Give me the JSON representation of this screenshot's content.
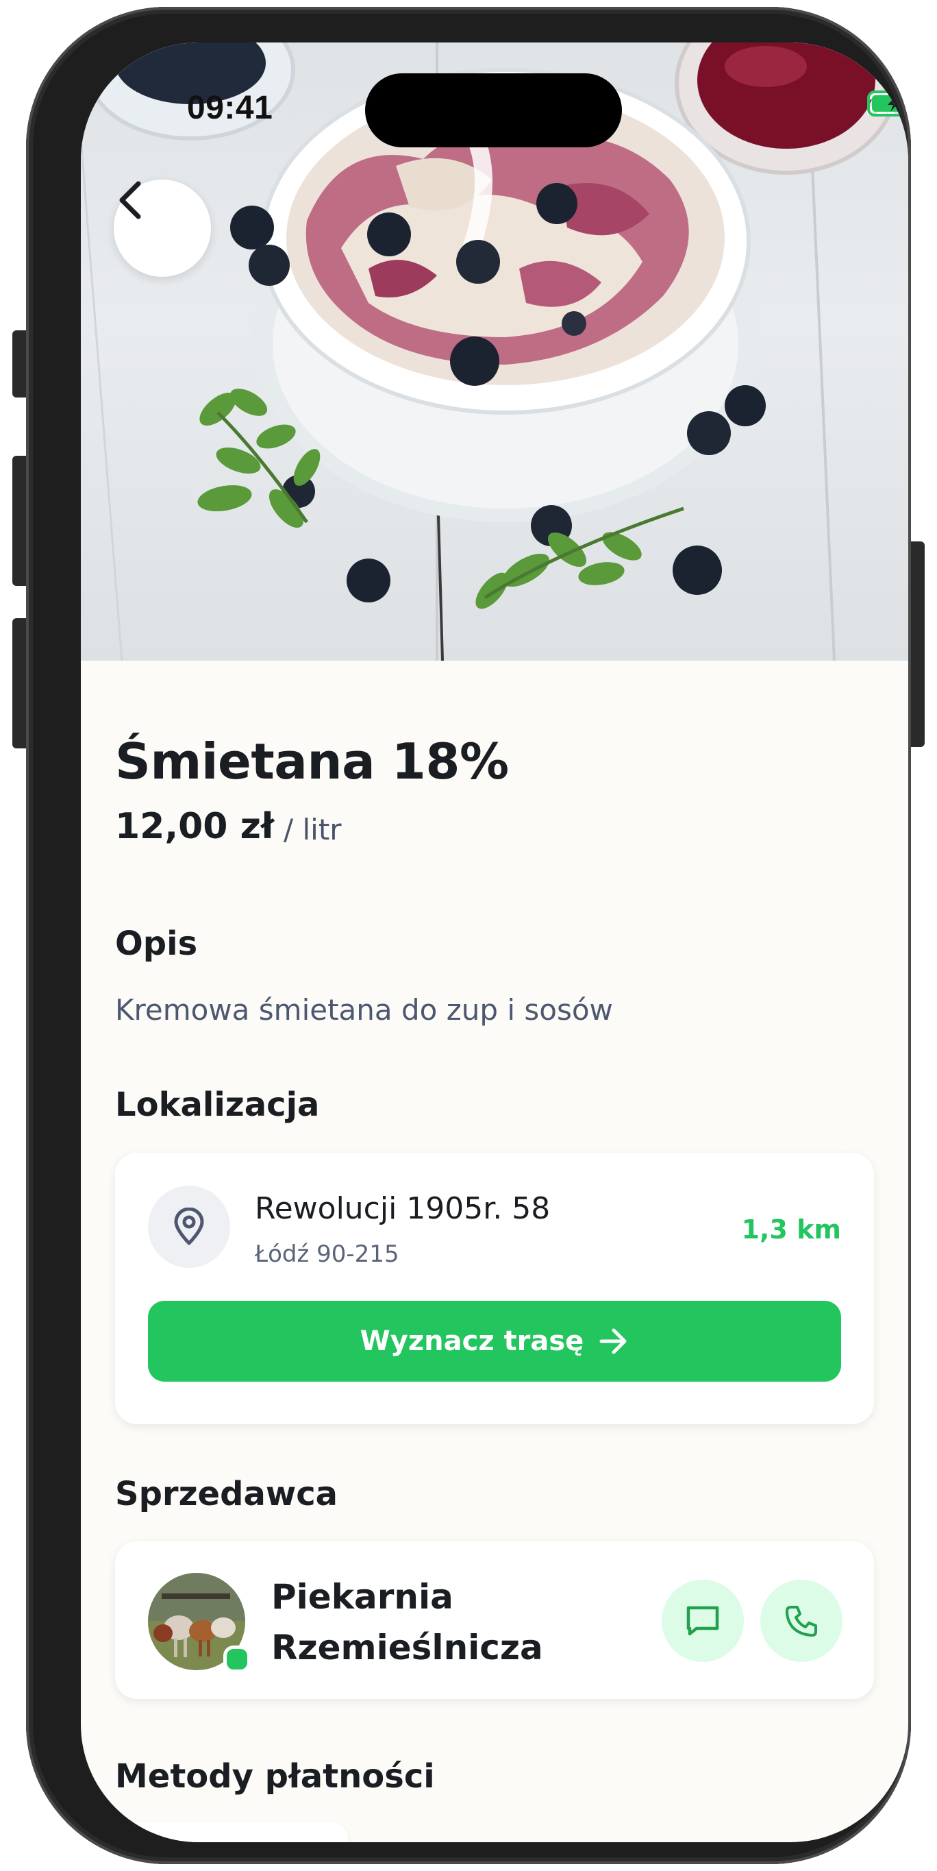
{
  "status_bar": {
    "time": "09:41"
  },
  "product": {
    "title": "Śmietana 18%",
    "price": "12,00 zł",
    "unit": "/ litr"
  },
  "description": {
    "heading": "Opis",
    "text": "Kremowa śmietana do zup i sosów"
  },
  "location": {
    "heading": "Lokalizacja",
    "address_line1": "Rewolucji 1905r. 58",
    "address_line2": "Łódź 90-215",
    "distance": "1,3 km",
    "route_button_label": "Wyznacz trasę"
  },
  "seller": {
    "heading": "Sprzedawca",
    "name": "Piekarnia Rzemieślnicza",
    "online": true
  },
  "payment": {
    "heading": "Metody płatności"
  },
  "colors": {
    "accent": "#22c55e",
    "accent_light": "#dcfce7",
    "background": "#fcfbf8",
    "text_primary": "#1a1d22",
    "text_secondary": "#4d5870"
  },
  "icons": {
    "back": "chevron-left-icon",
    "location": "map-pin-icon",
    "route": "arrow-right-icon",
    "message": "message-icon",
    "phone": "phone-icon"
  }
}
